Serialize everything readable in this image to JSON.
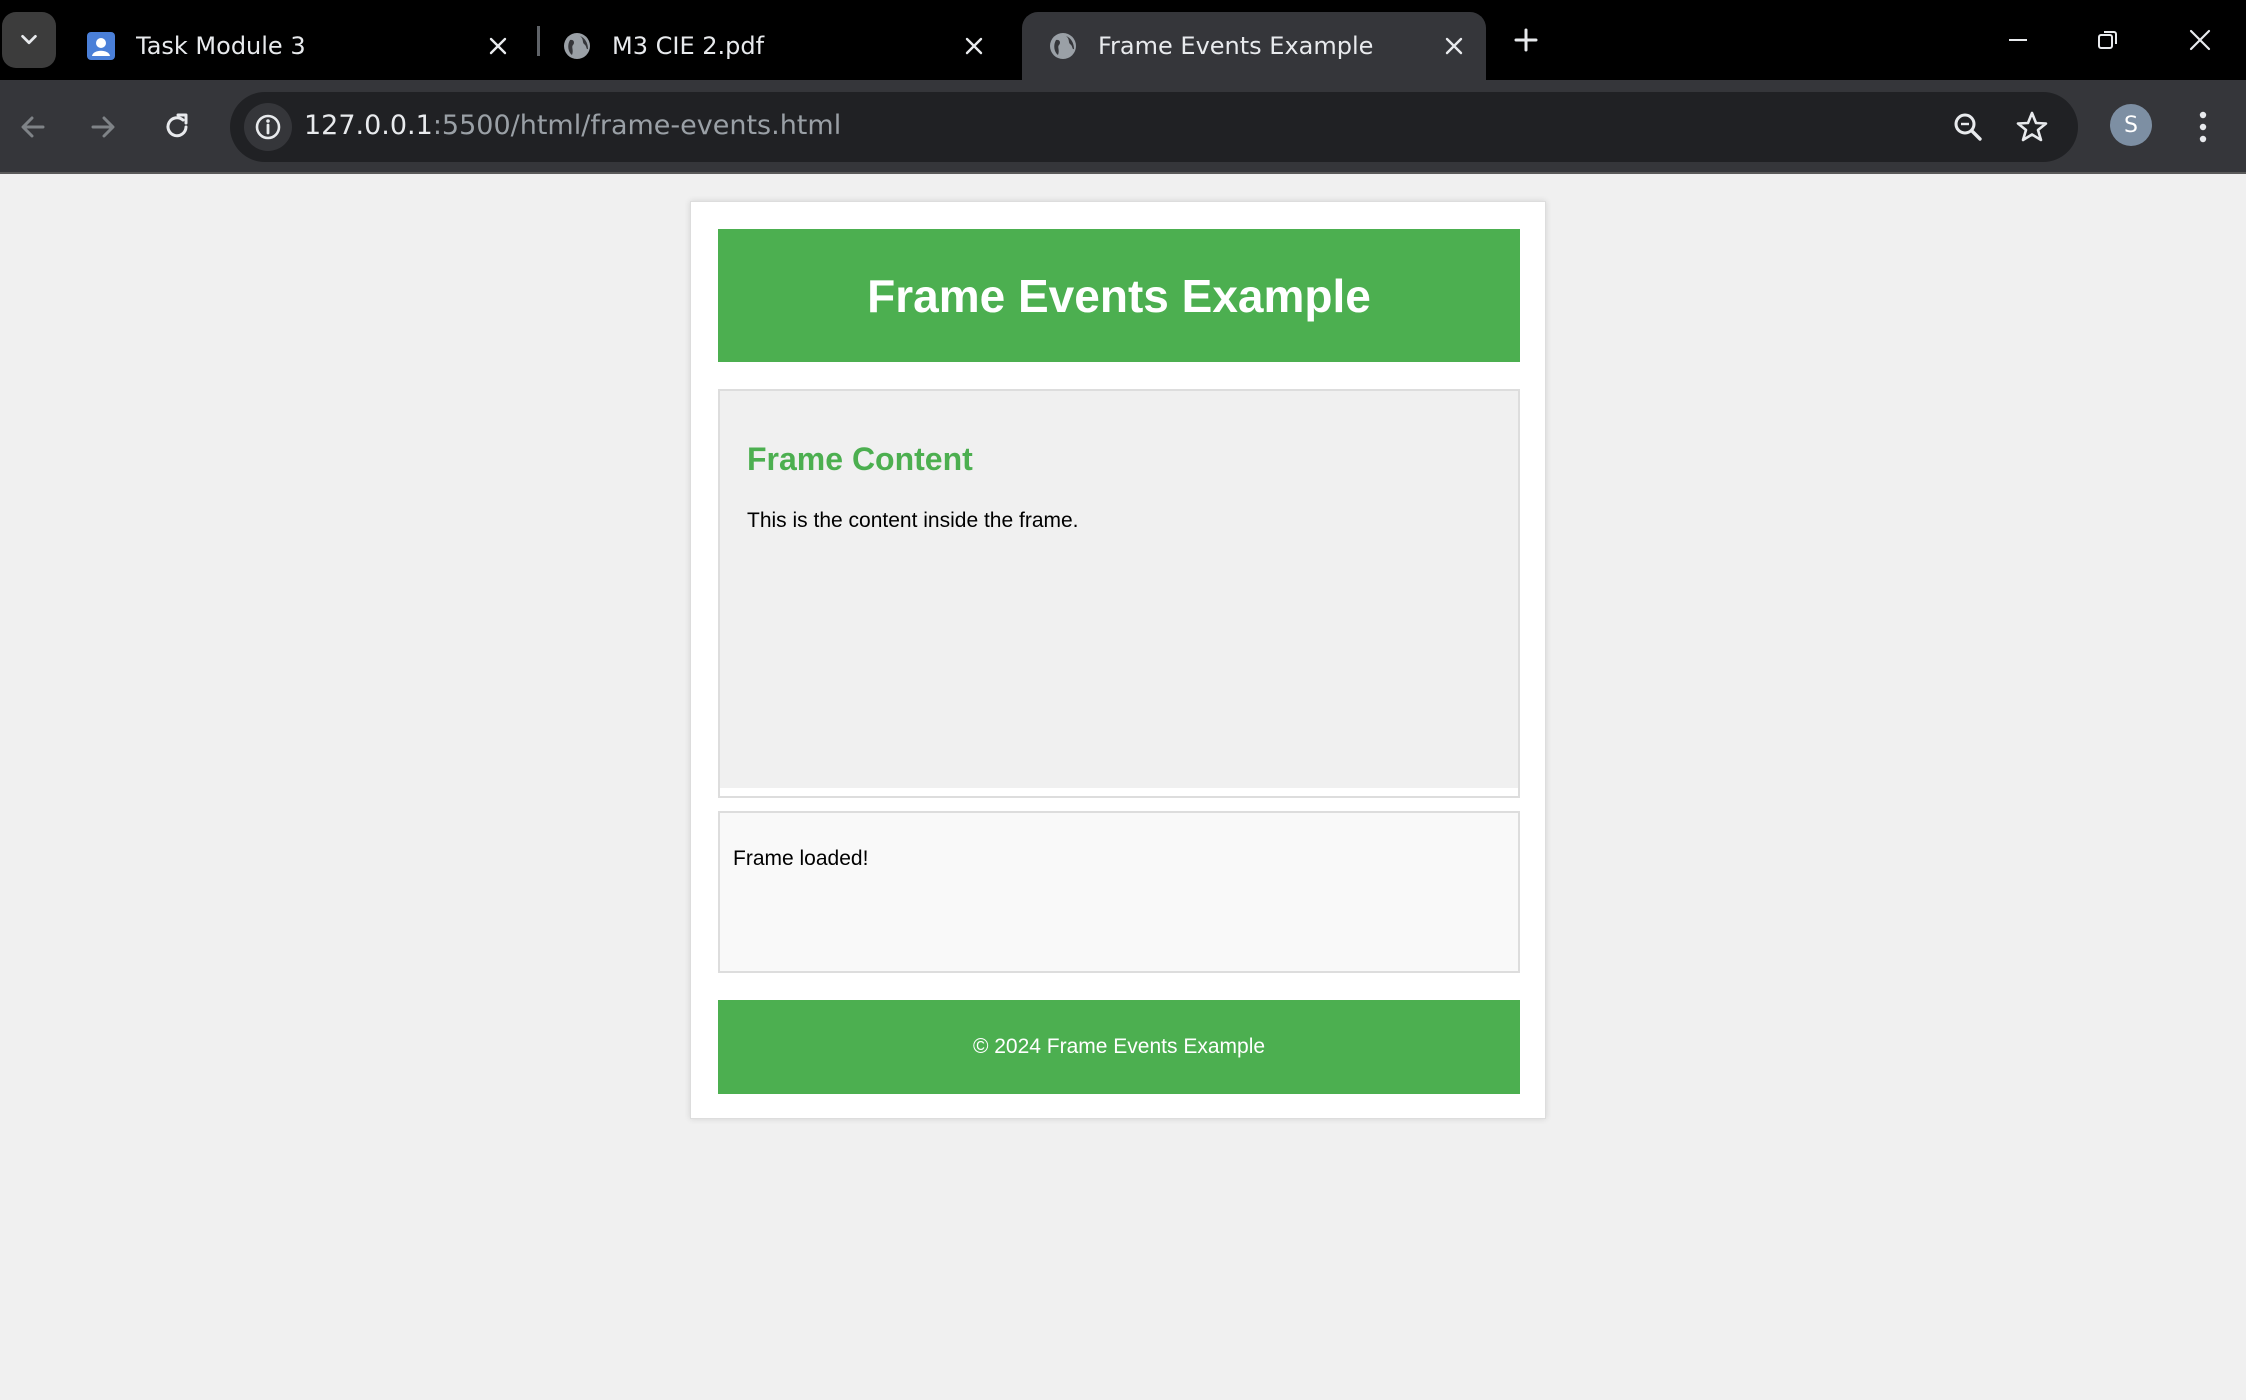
{
  "browser": {
    "tabs": [
      {
        "title": "Task Module 3",
        "icon": "person-doc-icon",
        "active": false
      },
      {
        "title": "M3 CIE 2.pdf",
        "icon": "globe-icon",
        "active": false
      },
      {
        "title": "Frame Events Example",
        "icon": "globe-icon",
        "active": true
      }
    ],
    "url_host": "127.0.0.1",
    "url_rest": ":5500/html/frame-events.html",
    "profile_initial": "S",
    "colors": {
      "tabstrip": "#000000",
      "toolbar": "#35363a",
      "omnibox": "#202124"
    }
  },
  "page": {
    "header_title": "Frame Events Example",
    "frame": {
      "heading": "Frame Content",
      "text": "This is the content inside the frame."
    },
    "status_text": "Frame loaded!",
    "footer_text": "© 2024 Frame Events Example",
    "colors": {
      "accent": "#4caf50",
      "background": "#f0f0f0"
    }
  }
}
